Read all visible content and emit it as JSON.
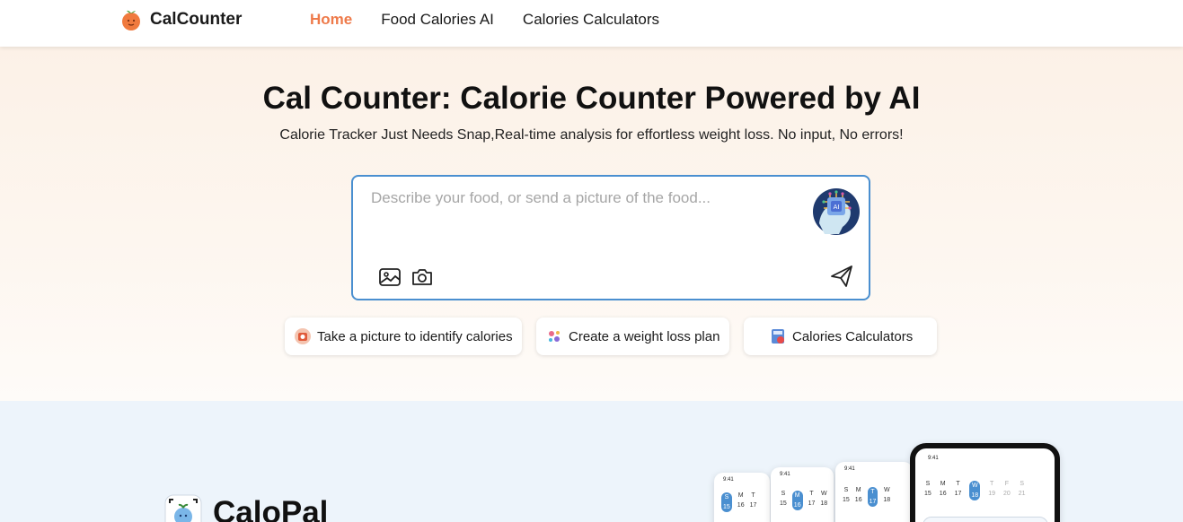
{
  "header": {
    "logo_text": "CalCounter",
    "nav": [
      {
        "label": "Home",
        "active": true
      },
      {
        "label": "Food Calories AI",
        "active": false
      },
      {
        "label": "Calories Calculators",
        "active": false
      }
    ]
  },
  "hero": {
    "title": "Cal Counter: Calorie Counter Powered by AI",
    "subtitle": "Calorie Tracker Just Needs Snap,Real-time analysis for effortless weight loss. No input, No errors!",
    "input_placeholder": "Describe your food, or send a picture of the food...",
    "ai_badge": "AI"
  },
  "chips": [
    {
      "label": "Take a picture to identify calories"
    },
    {
      "label": "Create a weight loss plan"
    },
    {
      "label": "Calories Calculators"
    }
  ],
  "app": {
    "name": "CaloPal",
    "phone_time": "9:41",
    "main_week": [
      {
        "day": "S",
        "date": "15"
      },
      {
        "day": "M",
        "date": "16"
      },
      {
        "day": "T",
        "date": "17"
      },
      {
        "day": "W",
        "date": "18",
        "selected": true
      },
      {
        "day": "T",
        "date": "19",
        "dim": true
      },
      {
        "day": "F",
        "date": "20",
        "dim": true
      },
      {
        "day": "S",
        "date": "21",
        "dim": true
      }
    ]
  },
  "colors": {
    "accent": "#ee7a4a",
    "input_border": "#4a8fd0",
    "hero_bg": "#fcf1e7",
    "lower_bg": "#edf4fb"
  }
}
